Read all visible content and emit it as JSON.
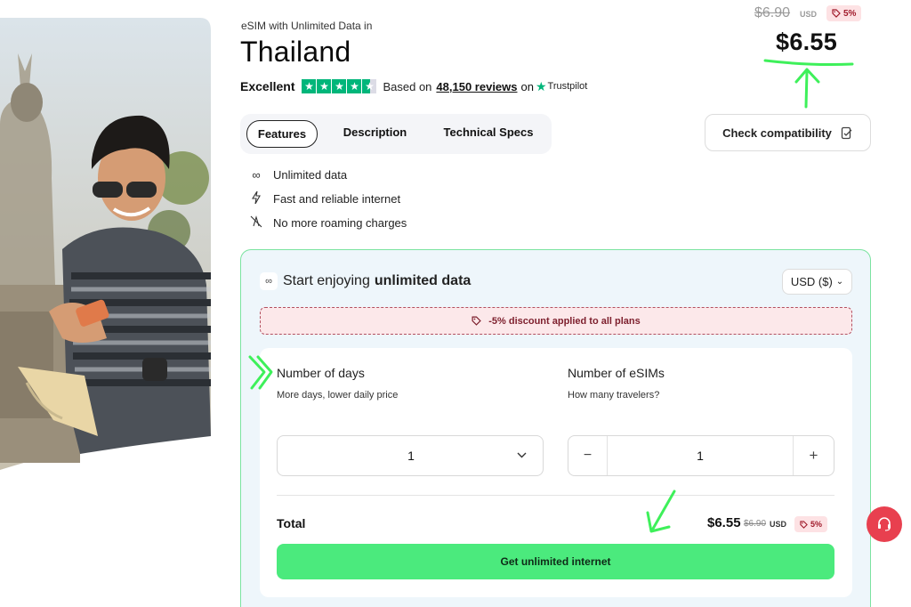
{
  "product": {
    "eyebrow": "eSIM with Unlimited Data in",
    "country": "Thailand"
  },
  "rating": {
    "label": "Excellent",
    "based_on": "Based on",
    "review_count": "48,150 reviews",
    "on": "on",
    "platform": "Trustpilot",
    "stars_value": 4.5
  },
  "price": {
    "old": "$6.90",
    "old_currency": "USD",
    "discount_badge": "5%",
    "current": "$6.55"
  },
  "tabs": [
    {
      "label": "Features",
      "active": true
    },
    {
      "label": "Description",
      "active": false
    },
    {
      "label": "Technical Specs",
      "active": false
    }
  ],
  "check_compatibility": "Check compatibility",
  "features": [
    {
      "icon": "infinity-icon",
      "text": "Unlimited data"
    },
    {
      "icon": "bolt-icon",
      "text": "Fast and reliable internet"
    },
    {
      "icon": "no-roaming-icon",
      "text": "No more roaming charges"
    }
  ],
  "plan": {
    "title_prefix": "Start enjoying",
    "title_bold": "unlimited data",
    "currency_selector": "USD ($)",
    "discount_note": "-5% discount applied to all plans",
    "days": {
      "title": "Number of days",
      "subtitle": "More days, lower daily price",
      "value": "1"
    },
    "esims": {
      "title": "Number of eSIMs",
      "subtitle": "How many travelers?",
      "value": "1"
    },
    "total": {
      "label": "Total",
      "price": "$6.55",
      "old_price": "$6.90",
      "currency": "USD",
      "badge": "5%"
    },
    "cta": "Get unlimited internet"
  },
  "colors": {
    "accent_green": "#4bea7d",
    "panel_border": "#7be3a0",
    "panel_bg": "#eef6fb",
    "discount_red": "#7d1f2d",
    "support_red": "#e8404f",
    "trustpilot_green": "#00b67a",
    "annotation_green": "#3ef05a"
  }
}
